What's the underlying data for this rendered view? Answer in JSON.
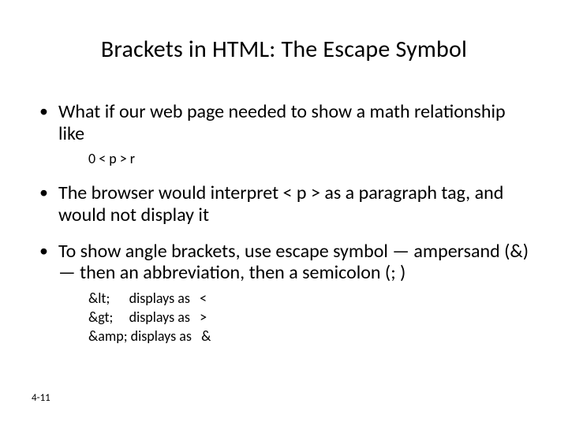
{
  "title": "Brackets in HTML: The Escape Symbol",
  "bullets": {
    "b1": "What if our web page needed to show a math relationship like",
    "b1_sub": "0 < p > r",
    "b2": "The browser would interpret < p > as a paragraph tag, and would not display it",
    "b3": "To show angle brackets, use escape symbol — ampersand (&) — then an abbreviation, then a semicolon (; )",
    "b3_rows": {
      "r1": "&lt;      displays as   <",
      "r2": "&gt;     displays as   >",
      "r3": "&amp; displays as   &"
    }
  },
  "footer": "4-11"
}
